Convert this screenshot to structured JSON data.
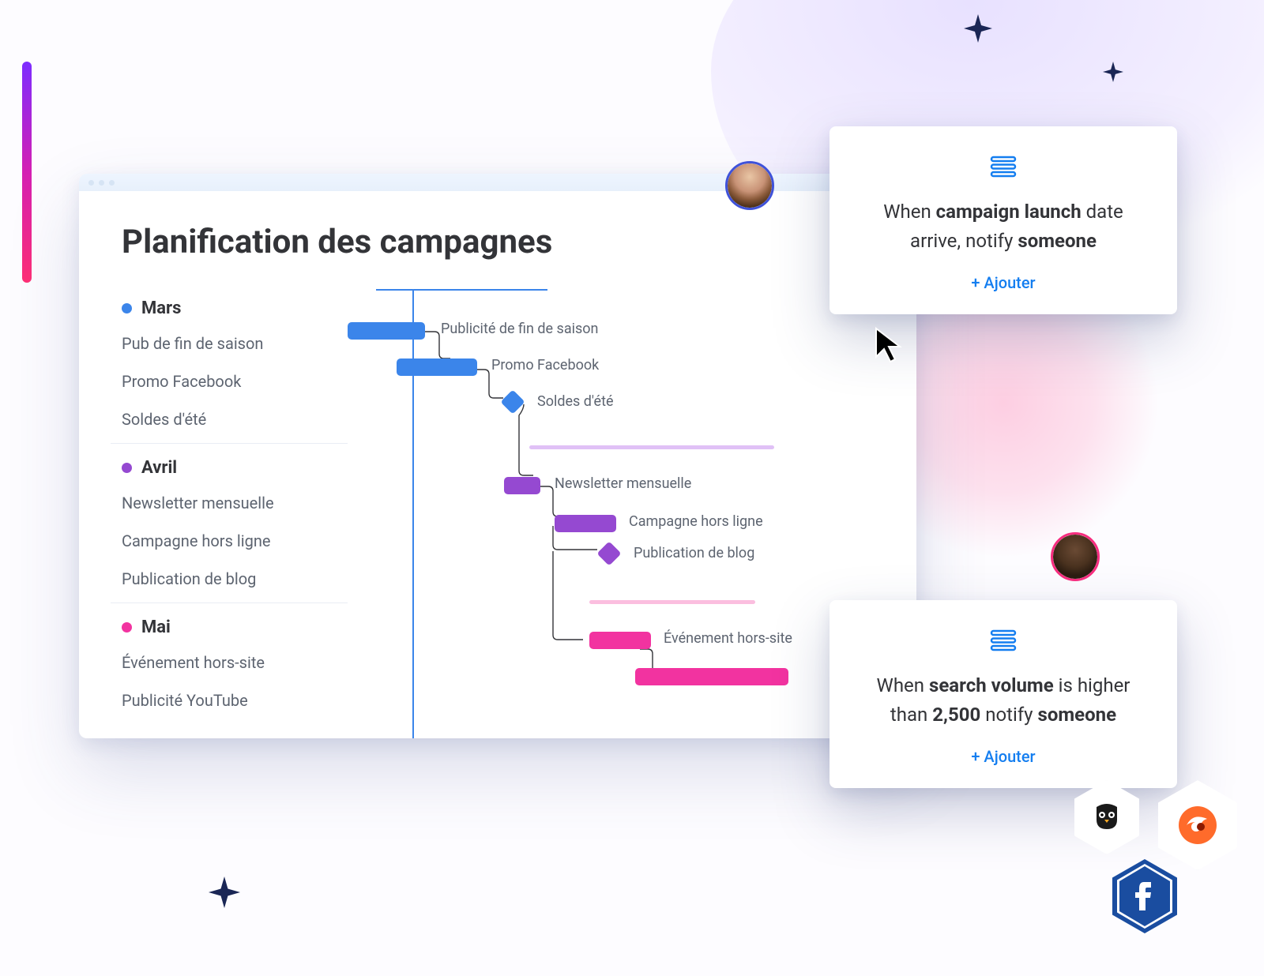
{
  "page": {
    "title": "Planification des campagnes"
  },
  "colors": {
    "blue": "#3b85ea",
    "purple": "#9549d1",
    "pink": "#f233a0",
    "cardAccent": "#147ef0"
  },
  "months": [
    {
      "name": "Mars",
      "bullet_color": "#3b85ea",
      "tasks": [
        {
          "label": "Pub de fin de saison",
          "bar_label": "Publicité de fin de saison"
        },
        {
          "label": "Promo Facebook",
          "bar_label": "Promo Facebook"
        },
        {
          "label": "Soldes d'été",
          "bar_label": "Soldes d'été"
        }
      ]
    },
    {
      "name": "Avril",
      "bullet_color": "#9549d1",
      "tasks": [
        {
          "label": "Newsletter mensuelle",
          "bar_label": "Newsletter mensuelle"
        },
        {
          "label": "Campagne hors ligne",
          "bar_label": "Campagne hors ligne"
        },
        {
          "label": "Publication de blog",
          "bar_label": "Publication de blog"
        }
      ]
    },
    {
      "name": "Mai",
      "bullet_color": "#f233a0",
      "tasks": [
        {
          "label": "Événement hors-site",
          "bar_label": "Événement hors-site"
        },
        {
          "label": "Publicité YouTube",
          "bar_label": ""
        }
      ]
    }
  ],
  "cards": [
    {
      "text_parts": [
        "When ",
        "campaign launch",
        " date arrive, notify ",
        "someone"
      ],
      "bold_indices": [
        1,
        3
      ],
      "add_label": "+ Ajouter"
    },
    {
      "text_parts": [
        "When ",
        "search volume",
        " is higher than ",
        "2,500",
        " notify ",
        "someone"
      ],
      "bold_indices": [
        1,
        3,
        5
      ],
      "add_label": "+ Ajouter"
    }
  ],
  "icon_names": {
    "sparkle": "sparkle-icon",
    "stack": "stack-icon",
    "cursor": "cursor-icon"
  }
}
